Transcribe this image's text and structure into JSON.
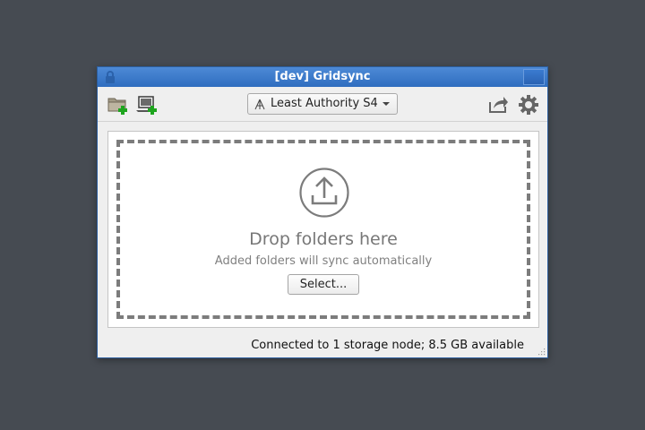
{
  "window": {
    "title": "[dev] Gridsync"
  },
  "toolbar": {
    "add_folder_icon": "folder-add-icon",
    "invite_icon": "laptop-add-icon",
    "grid_selector": {
      "selected": "Least Authority S4"
    },
    "share_icon": "share-icon",
    "settings_icon": "gear-icon"
  },
  "dropzone": {
    "icon": "upload-icon",
    "title": "Drop folders here",
    "subtitle": "Added folders will sync automatically",
    "select_label": "Select..."
  },
  "status": {
    "text": "Connected to 1 storage node; 8.5 GB available"
  },
  "colors": {
    "desktop": "#464b52",
    "titlebar": "#3a7acb",
    "add_badge": "#1ea51e"
  }
}
